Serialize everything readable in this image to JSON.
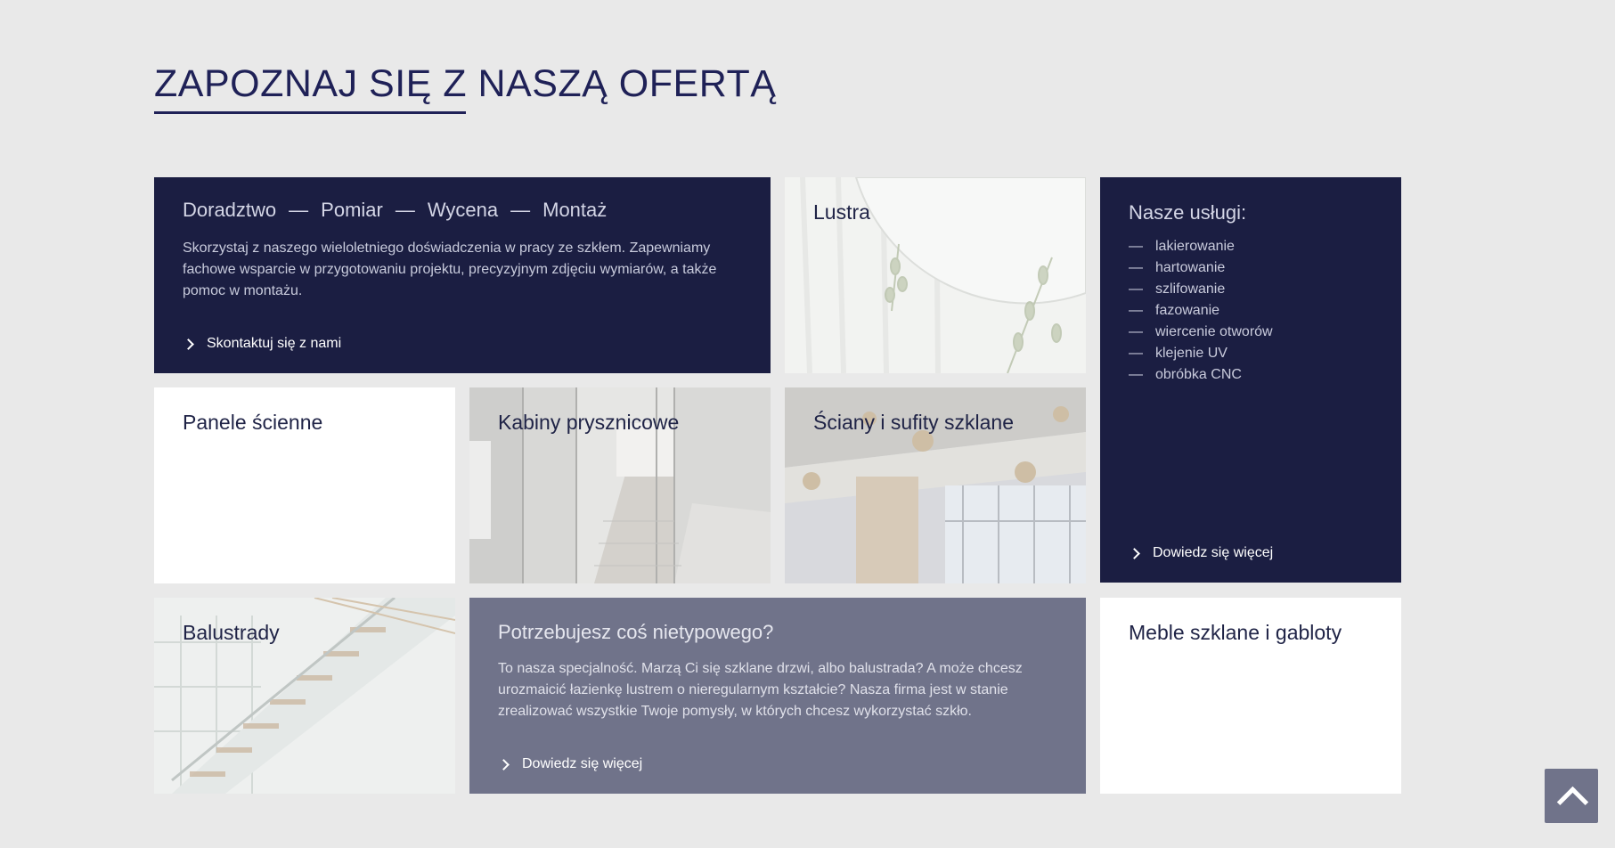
{
  "heading": "ZAPOZNAJ SIĘ Z NASZĄ OFERTĄ",
  "consult": {
    "steps": [
      "Doradztwo",
      "Pomiar",
      "Wycena",
      "Montaż"
    ],
    "separator": "—",
    "description": "Skorzystaj z naszego wieloletniego doświadczenia w pracy ze szkłem. Zapewniamy fachowe wsparcie w przygotowaniu projektu, precyzyjnym zdjęciu wymiarów, a także pomoc w montażu.",
    "cta": "Skontaktuj się z nami"
  },
  "tiles": {
    "lustra": "Lustra",
    "panele": "Panele ścienne",
    "kabiny": "Kabiny prysznicowe",
    "sciany": "Ściany i sufity szklane",
    "balustrady": "Balustrady",
    "meble": "Meble szklane i gabloty"
  },
  "services": {
    "title": "Nasze usługi:",
    "dash": "—",
    "items": [
      "lakierowanie",
      "hartowanie",
      "szlifowanie",
      "fazowanie",
      "wiercenie otworów",
      "klejenie UV",
      "obróbka CNC"
    ],
    "cta": "Dowiedz się więcej"
  },
  "custom": {
    "title": "Potrzebujesz coś nietypowego?",
    "description": "To nasza specjalność. Marzą Ci się szklane drzwi, albo balustrada? A może chcesz urozmaicić łazienkę lustrem o nieregularnym kształcie? Nasza firma jest w stanie zrealizować wszystkie Twoje pomysły, w których chcesz wykorzystać szkło.",
    "cta": "Dowiedz się więcej"
  },
  "colors": {
    "navy": "#1b1e42",
    "slate": "#70738a",
    "background": "#e9e9e9",
    "heading": "#1f2157"
  },
  "icons": {
    "cta": "chevron-right-icon",
    "scroll_top": "chevron-up-icon"
  }
}
